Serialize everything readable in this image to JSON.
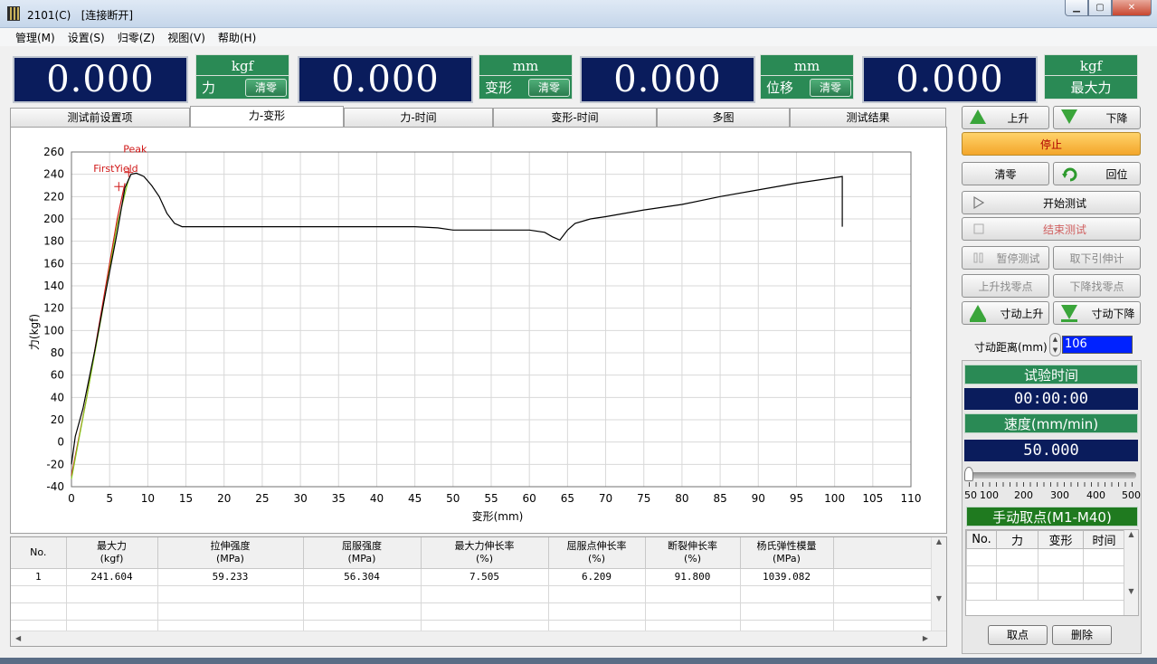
{
  "window": {
    "title": "2101(C)",
    "status": "[连接断开]",
    "min_label": "▁",
    "max_label": "▢",
    "close_label": "✕"
  },
  "menu": [
    "管理(M)",
    "设置(S)",
    "归零(Z)",
    "视图(V)",
    "帮助(H)"
  ],
  "readouts": [
    {
      "value": "0.000",
      "unit": "kgf",
      "label": "力",
      "clear": "清零"
    },
    {
      "value": "0.000",
      "unit": "mm",
      "label": "变形",
      "clear": "清零"
    },
    {
      "value": "0.000",
      "unit": "mm",
      "label": "位移",
      "clear": "清零"
    },
    {
      "value": "0.000",
      "unit": "kgf",
      "label": "最大力",
      "clear": ""
    }
  ],
  "tabs": [
    {
      "label": "测试前设置项",
      "active": false
    },
    {
      "label": "力-变形",
      "active": true
    },
    {
      "label": "力-时间",
      "active": false
    },
    {
      "label": "变形-时间",
      "active": false
    },
    {
      "label": "多图",
      "active": false
    },
    {
      "label": "测试结果",
      "active": false
    }
  ],
  "chart_data": {
    "type": "line",
    "xlabel": "变形(mm)",
    "ylabel": "力(kgf)",
    "xlim": [
      0,
      110
    ],
    "ylim": [
      -40,
      260
    ],
    "xticks": [
      0,
      5,
      10,
      15,
      20,
      25,
      30,
      35,
      40,
      45,
      50,
      55,
      60,
      65,
      70,
      75,
      80,
      85,
      90,
      95,
      100,
      105,
      110
    ],
    "yticks": [
      -40,
      -20,
      0,
      20,
      40,
      60,
      80,
      100,
      120,
      140,
      160,
      180,
      200,
      220,
      240,
      260
    ],
    "grid": true,
    "series": [
      {
        "color": "#000000",
        "x": [
          0,
          0.5,
          1.5,
          3,
          4.5,
          6,
          7,
          7.8,
          8.5,
          9.5,
          10.5,
          11.5,
          12.5,
          13.5,
          14.5,
          20,
          30,
          40,
          45,
          48,
          50,
          55,
          60,
          62,
          63,
          64,
          65,
          66,
          68,
          70,
          75,
          80,
          85,
          90,
          95,
          100,
          101,
          101
        ],
        "y": [
          -20,
          5,
          30,
          80,
          135,
          188,
          228,
          240,
          241,
          238,
          230,
          220,
          205,
          196,
          193,
          193,
          193,
          193,
          193,
          192,
          190,
          190,
          190,
          188,
          184,
          181,
          190,
          196,
          200,
          202,
          208,
          213,
          220,
          226,
          232,
          237,
          238,
          193
        ]
      },
      {
        "color": "#d01818",
        "x": [
          0,
          2,
          4,
          6,
          7
        ],
        "y": [
          -30,
          40,
          120,
          200,
          232
        ]
      },
      {
        "color": "#88cc20",
        "x": [
          0,
          2,
          4,
          6,
          7.5
        ],
        "y": [
          -33,
          40,
          115,
          195,
          236
        ]
      }
    ],
    "annotations": [
      {
        "text": "FirstYield",
        "x": 6.2,
        "y": 229,
        "color": "#d01818"
      },
      {
        "text": "Peak",
        "x": 7.5,
        "y": 241.6,
        "color": "#d01818"
      }
    ]
  },
  "results_table": {
    "headers": [
      [
        "No.",
        ""
      ],
      [
        "最大力",
        "(kgf)"
      ],
      [
        "拉伸强度",
        "(MPa)"
      ],
      [
        "屈服强度",
        "(MPa)"
      ],
      [
        "最大力伸长率",
        "(%)"
      ],
      [
        "屈服点伸长率",
        "(%)"
      ],
      [
        "断裂伸长率",
        "(%)"
      ],
      [
        "杨氏弹性模量",
        "(MPa)"
      ]
    ],
    "rows": [
      [
        "1",
        "241.604",
        "59.233",
        "56.304",
        "7.505",
        "6.209",
        "91.800",
        "1039.082"
      ]
    ]
  },
  "controls": {
    "up": "上升",
    "down": "下降",
    "stop": "停止",
    "zero": "清零",
    "return": "回位",
    "start_test": "开始测试",
    "end_test": "结束测试",
    "pause_test": "暂停测试",
    "remove_extensometer": "取下引伸计",
    "up_find_zero": "上升找零点",
    "down_find_zero": "下降找零点",
    "jog_up": "寸动上升",
    "jog_down": "寸动下降",
    "jog_distance_label": "寸动距离(mm)",
    "jog_distance_value": "106",
    "test_time_label": "试验时间",
    "test_time_value": "00:00:00",
    "speed_label": "速度(mm/min)",
    "speed_value": "50.000",
    "slider_labels": [
      "50",
      "100",
      "200",
      "300",
      "400",
      "500"
    ],
    "slider_level_fraction": 0.0,
    "manual_points_label": "手动取点(M1-M40)",
    "manual_table_headers": [
      "No.",
      "力",
      "变形",
      "时间"
    ],
    "take_point": "取点",
    "delete": "删除"
  }
}
